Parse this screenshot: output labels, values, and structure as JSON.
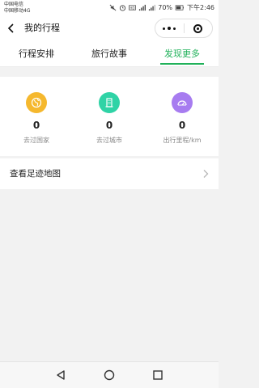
{
  "status_bar": {
    "carrier_1": "中国电信",
    "carrier_2": "中国移动4G",
    "battery": "70%",
    "time": "下午2:46"
  },
  "header": {
    "title": "我的行程"
  },
  "tabs": [
    {
      "label": "行程安排",
      "active": false
    },
    {
      "label": "旅行故事",
      "active": false
    },
    {
      "label": "发现更多",
      "active": true
    }
  ],
  "stats": [
    {
      "value": "0",
      "label": "去过国家",
      "icon": "globe-icon",
      "color": "#f5b82e"
    },
    {
      "value": "0",
      "label": "去过城市",
      "icon": "building-icon",
      "color": "#2fd3a6"
    },
    {
      "value": "0",
      "label": "出行里程/km",
      "icon": "speedometer-icon",
      "color": "#a77cf0"
    }
  ],
  "footprint": {
    "label": "查看足迹地图"
  },
  "colors": {
    "accent": "#20b15a"
  }
}
